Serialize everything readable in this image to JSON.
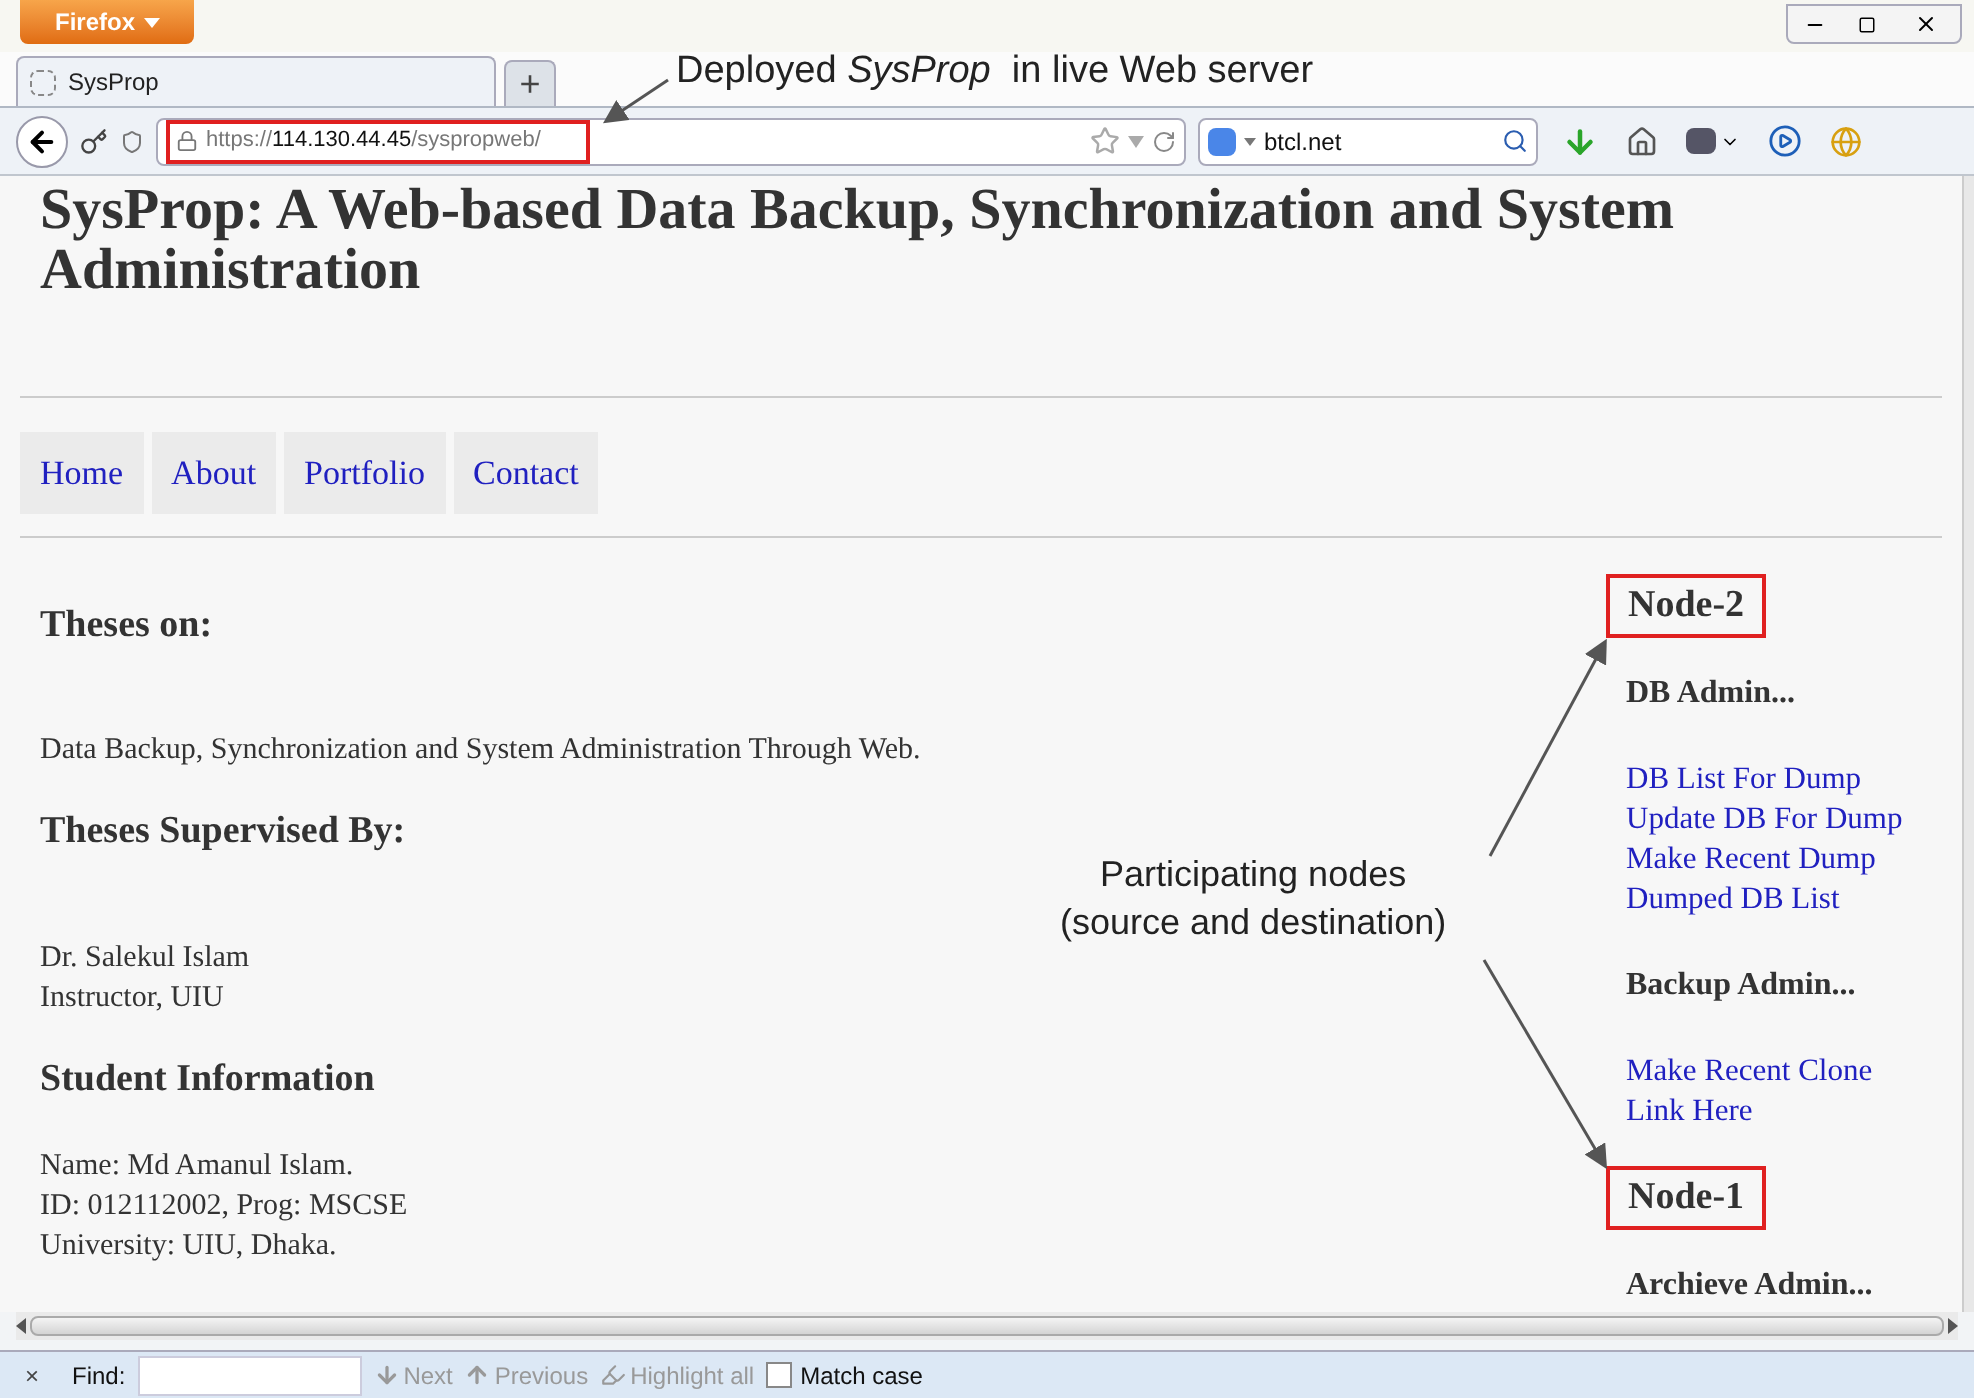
{
  "browser": {
    "app_menu": "Firefox",
    "tab": {
      "title": "SysProp",
      "selected": true
    },
    "new_tab": "+",
    "url": {
      "scheme": "https://",
      "host": "114.130.44.45",
      "path": "/syspropweb/"
    },
    "search": {
      "value": "btcl.net"
    }
  },
  "page": {
    "title": "SysProp: A Web-based Data Backup, Synchronization and System Administration",
    "nav": [
      {
        "label": "Home"
      },
      {
        "label": "About"
      },
      {
        "label": "Portfolio"
      },
      {
        "label": "Contact"
      }
    ],
    "main": [
      {
        "kind": "heading",
        "text": "Theses on:"
      },
      {
        "kind": "paragraph",
        "lines": [
          "Data Backup, Synchronization and System Administration Through Web."
        ]
      },
      {
        "kind": "heading",
        "text": "Theses Supervised By:"
      },
      {
        "kind": "paragraph",
        "lines": [
          "Dr. Salekul Islam",
          "Instructor, UIU"
        ]
      },
      {
        "kind": "heading",
        "text": "Student Information"
      },
      {
        "kind": "paragraph",
        "lines": [
          "Name: Md Amanul Islam.",
          "ID: 012112002, Prog: MSCSE",
          "University: UIU, Dhaka."
        ]
      }
    ],
    "sidebar": [
      {
        "kind": "node",
        "text": "Node-2"
      },
      {
        "kind": "heading",
        "text": "DB Admin..."
      },
      {
        "kind": "links",
        "links": [
          "DB List For Dump",
          "Update DB For Dump",
          "Make Recent Dump",
          "Dumped DB List"
        ]
      },
      {
        "kind": "heading",
        "text": "Backup Admin..."
      },
      {
        "kind": "links",
        "links": [
          "Make Recent Clone",
          "Link Here"
        ]
      },
      {
        "kind": "node",
        "text": "Node-1"
      },
      {
        "kind": "heading",
        "text": "Archieve Admin..."
      }
    ]
  },
  "annotations": {
    "deployed": "Deployed *SysProp*  in live Web server",
    "participating": [
      "Participating nodes",
      "(source and destination)"
    ]
  },
  "find_bar": {
    "close": "×",
    "label": "Find:",
    "next": "Next",
    "previous": "Previous",
    "highlight": "Highlight all",
    "match_case": {
      "label": "Match case",
      "checked": false
    }
  }
}
